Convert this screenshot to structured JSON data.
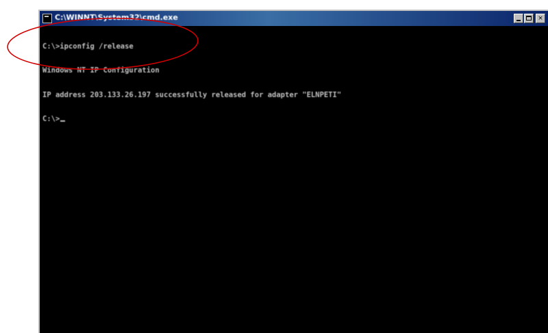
{
  "window": {
    "title": "C:\\WINNT\\System32\\cmd.exe",
    "buttons": {
      "minimize": "",
      "maximize": "",
      "close": "×"
    }
  },
  "console": {
    "lines": [
      "C:\\>ipconfig /release",
      "Windows NT IP Configuration",
      "IP address 203.133.26.197 successfully released for adapter \"ELNPETI\"",
      "C:\\>"
    ]
  },
  "annotation": {
    "color": "#d00000"
  },
  "colors": {
    "console_bg": "#000000",
    "console_text": "#c0c0c0",
    "titlebar": "#0a246a"
  }
}
